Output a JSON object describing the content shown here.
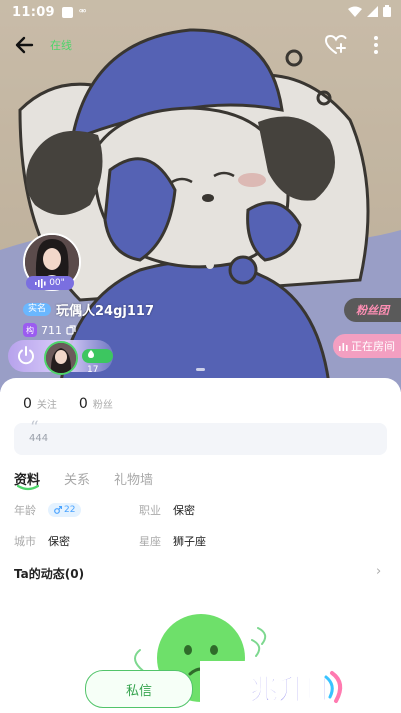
{
  "status_bar": {
    "time": "11:09",
    "notification_glyph": "⚮"
  },
  "top_nav": {
    "online_status": "在线"
  },
  "profile": {
    "voice_duration": "00\"",
    "tag": "实名",
    "username": "玩偶人24gj117",
    "level_badge": "构",
    "level_value": "711",
    "room_count": "17"
  },
  "side_badges": {
    "fan_club": "粉丝团",
    "in_room": "正在房间"
  },
  "stats": [
    {
      "value": "0",
      "label": "关注"
    },
    {
      "value": "0",
      "label": "粉丝"
    }
  ],
  "bio": {
    "text": "444"
  },
  "tabs": [
    {
      "label": "资料",
      "active": true
    },
    {
      "label": "关系",
      "active": false
    },
    {
      "label": "礼物墙",
      "active": false
    }
  ],
  "info": {
    "age_label": "年龄",
    "age_value": "22",
    "job_label": "职业",
    "job_value": "保密",
    "city_label": "城市",
    "city_value": "保密",
    "zodiac_label": "星座",
    "zodiac_value": "狮子座"
  },
  "dynamics": {
    "label": "Ta的动态(0)"
  },
  "actions": {
    "message_label": "私信"
  },
  "watermark": {
    "text": "兆升旺"
  },
  "colors": {
    "online_green": "#4ed56a",
    "accent_green": "#52c46a",
    "fan_club_pink": "#ff8fb4",
    "in_room_pink": "#f39fc1",
    "avatar_frame_purple": "#7a6fe0"
  },
  "icons": {
    "back": "arrow-left-icon",
    "follow": "heart-plus-icon",
    "more": "more-vertical-icon",
    "power": "power-icon",
    "voice": "sound-wave-icon",
    "gender": "male-icon",
    "arrow": "chevron-right-icon"
  }
}
